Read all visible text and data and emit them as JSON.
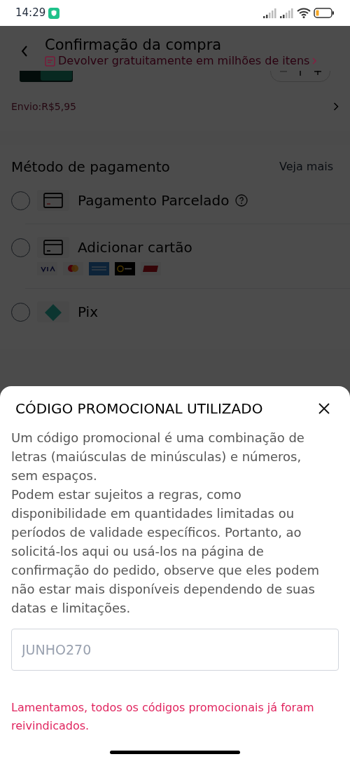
{
  "status_bar": {
    "time": "14:29"
  },
  "header": {
    "title": "Confirmação da compra",
    "subtitle": "Devolver gratuitamente em milhões de itens"
  },
  "shipping": {
    "label": "Envio:R$5,95"
  },
  "payment": {
    "title": "Método de pagamento",
    "more_link": "Veja mais",
    "methods": [
      {
        "label": "Pagamento Parcelado",
        "kind": "installment",
        "selected": false
      },
      {
        "label": "Adicionar cartão",
        "kind": "card",
        "selected": false
      },
      {
        "label": "Pix",
        "kind": "pix",
        "selected": false
      }
    ]
  },
  "sheet": {
    "title": "CÓDIGO PROMOCIONAL UTILIZADO",
    "paragraphs": [
      "Um código promocional é uma combinação de letras (maiúsculas de minúsculas) e números, sem espaços.",
      "Podem estar sujeitos a regras, como disponibilidade em quantidades limitadas ou períodos de validade específicos. Portanto, ao solicitá-los aqui ou usá-los na página de confirmação do pedido, observe que eles podem não estar mais disponíveis dependendo de suas datas e limitações."
    ],
    "code_field": {
      "value": "JUNHO270"
    },
    "error": "Lamentamos, todos os códigos promocionais já foram reivindicados."
  }
}
